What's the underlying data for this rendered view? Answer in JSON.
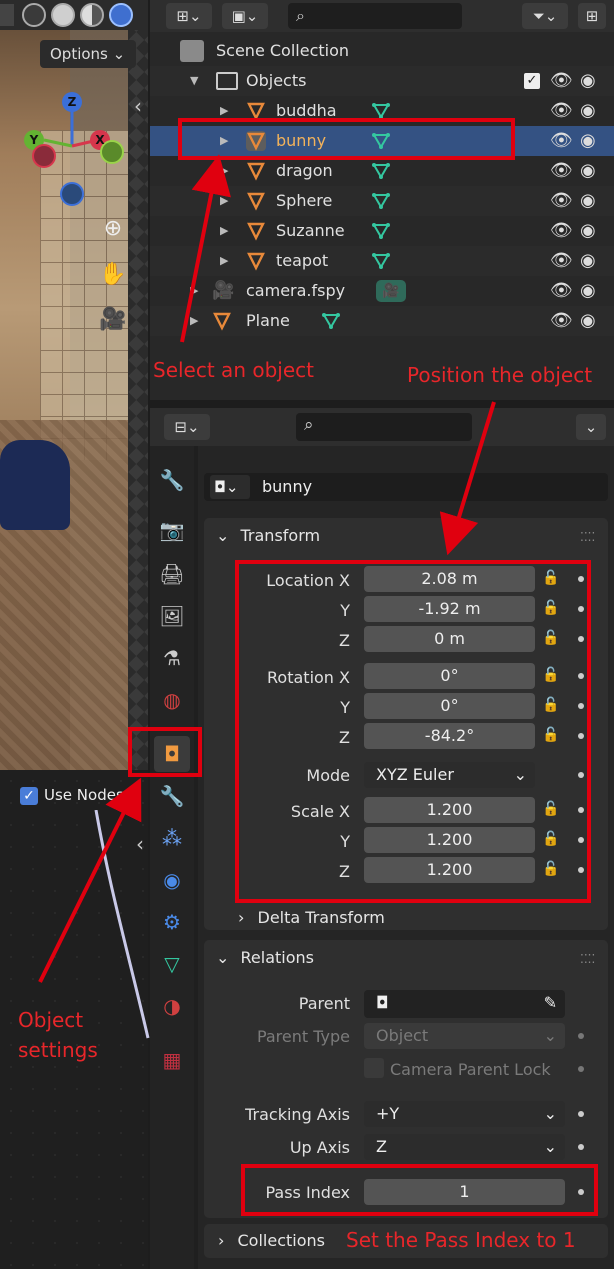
{
  "viewport": {
    "options_label": "Options",
    "gizmo": {
      "z": "Z",
      "y": "Y",
      "x": "X"
    },
    "tools": [
      "zoom-icon",
      "hand-icon",
      "camera-icon"
    ],
    "collapse_glyph": "‹"
  },
  "node_editor": {
    "use_nodes_label": "Use Nodes",
    "use_nodes_checked": true,
    "collapse_glyph": "‹"
  },
  "outliner": {
    "search_placeholder": "",
    "scene_collection": "Scene Collection",
    "objects_collection": "Objects",
    "rows": [
      {
        "label": "buddha",
        "type": "mesh"
      },
      {
        "label": "bunny",
        "type": "mesh",
        "selected": true
      },
      {
        "label": "dragon",
        "type": "mesh"
      },
      {
        "label": "Sphere",
        "type": "mesh"
      },
      {
        "label": "Suzanne",
        "type": "mesh"
      },
      {
        "label": "teapot",
        "type": "mesh"
      },
      {
        "label": "camera.fspy",
        "type": "camera"
      },
      {
        "label": "Plane",
        "type": "mesh"
      }
    ]
  },
  "properties": {
    "object_name": "bunny",
    "transform": {
      "title": "Transform",
      "location_label": "Location X",
      "location": [
        "2.08 m",
        "-1.92 m",
        "0 m"
      ],
      "rotation_label": "Rotation X",
      "rotation": [
        "0°",
        "0°",
        "-84.2°"
      ],
      "mode_label": "Mode",
      "mode_value": "XYZ Euler",
      "scale_label": "Scale X",
      "scale": [
        "1.200",
        "1.200",
        "1.200"
      ],
      "axis_y": "Y",
      "axis_z": "Z",
      "delta_title": "Delta Transform"
    },
    "relations": {
      "title": "Relations",
      "parent_label": "Parent",
      "parent_type_label": "Parent Type",
      "parent_type_value": "Object",
      "camera_parent_lock": "Camera Parent Lock",
      "tracking_axis_label": "Tracking Axis",
      "tracking_axis_value": "+Y",
      "up_axis_label": "Up Axis",
      "up_axis_value": "Z",
      "pass_index_label": "Pass Index",
      "pass_index_value": "1"
    },
    "collections_title": "Collections"
  },
  "annotations": {
    "select_object": "Select an object",
    "position_object": "Position the object",
    "object_settings_line1": "Object",
    "object_settings_line2": "settings",
    "set_pass_index": "Set the Pass Index to 1"
  },
  "colors": {
    "selection_row": "#345283",
    "selected_text": "#f2b25b",
    "annotation_red": "#e0000f",
    "mesh_orange": "#e8893a",
    "data_green": "#34c7a0"
  }
}
